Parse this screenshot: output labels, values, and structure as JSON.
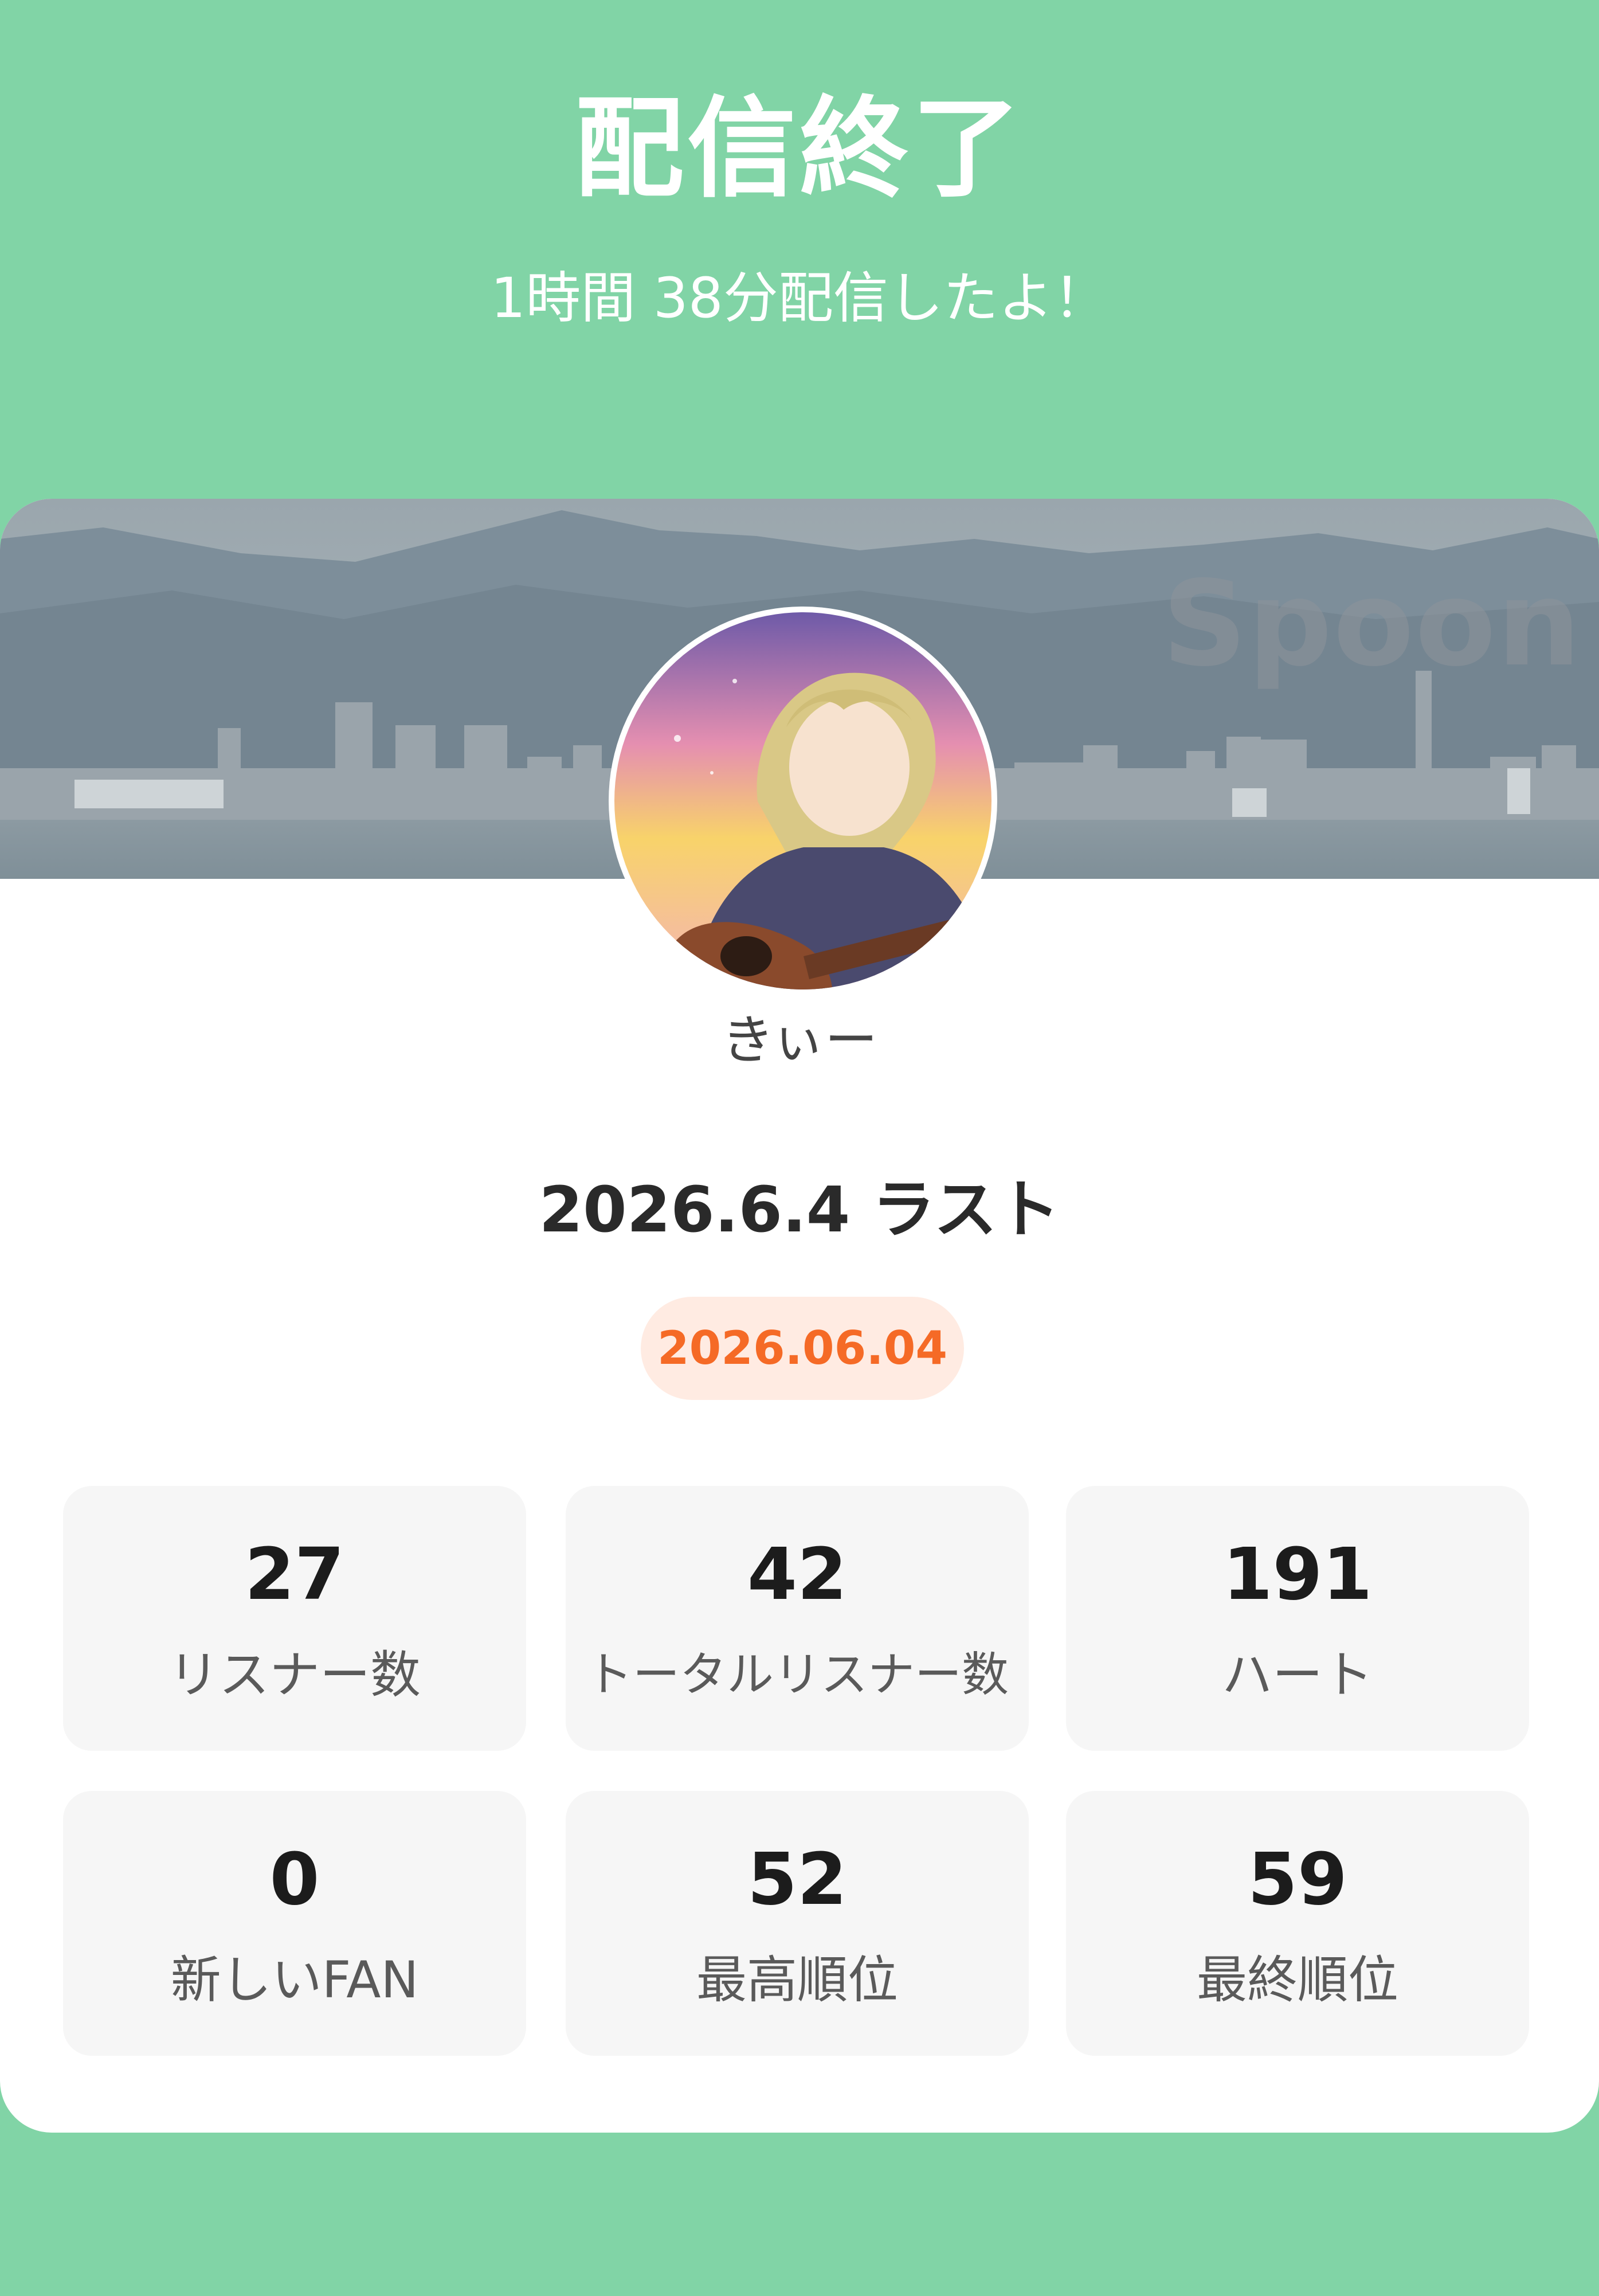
{
  "header": {
    "title": "配信終了",
    "subtitle": "1時間 38分配信したよ！"
  },
  "card": {
    "banner_watermark": "Spoon",
    "username": "きぃー",
    "stream_title": "2026.6.4 ラスト",
    "date": "2026.06.04"
  },
  "stats": [
    {
      "value": "27",
      "label": "リスナー数"
    },
    {
      "value": "42",
      "label": "トータルリスナー数"
    },
    {
      "value": "191",
      "label": "ハート"
    },
    {
      "value": "0",
      "label": "新しいFAN"
    },
    {
      "value": "52",
      "label": "最高順位"
    },
    {
      "value": "59",
      "label": "最終順位"
    }
  ],
  "colors": {
    "background": "#81d4a6",
    "date_text": "#f56a26",
    "date_badge_bg": "#ffebe2"
  }
}
